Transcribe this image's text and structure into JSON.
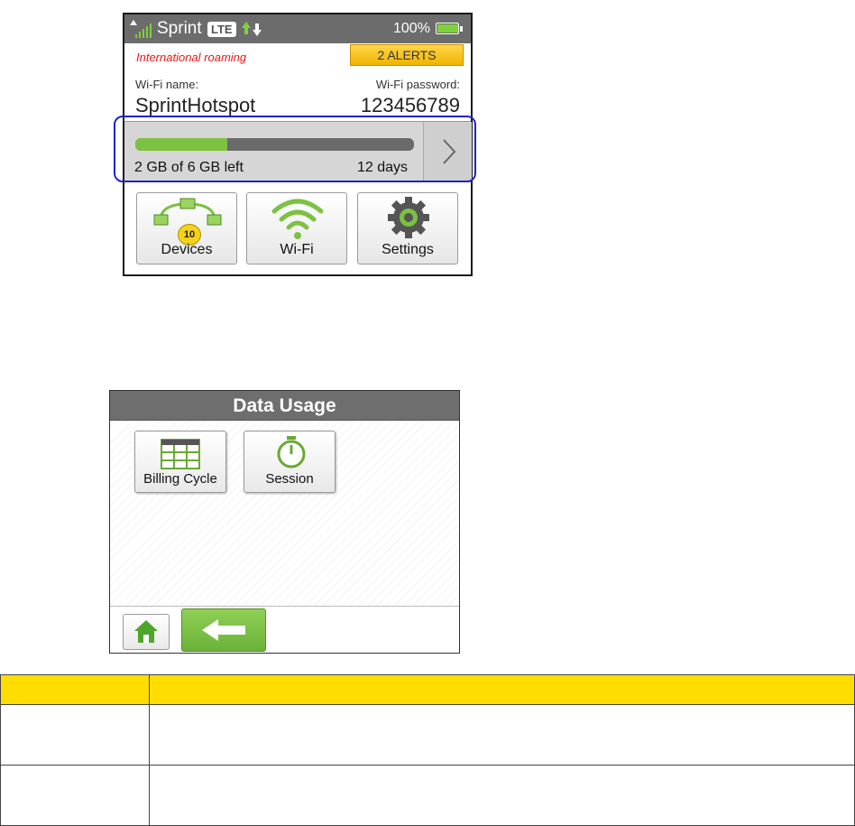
{
  "home_screen": {
    "status_bar": {
      "carrier": "Sprint",
      "network": "LTE",
      "battery_percent": "100%",
      "battery_level": 1.0
    },
    "roaming_text": "International roaming",
    "alerts_label": "2 ALERTS",
    "wifi_name_label": "Wi-Fi name:",
    "wifi_name": "SprintHotspot",
    "wifi_password_label": "Wi-Fi password:",
    "wifi_password": "123456789",
    "usage": {
      "left_text": "2 GB of 6 GB left",
      "days_text": "12 days",
      "used_fraction": 0.33
    },
    "tiles": [
      {
        "label": "Devices",
        "badge": "10",
        "icon": "devices-network-icon"
      },
      {
        "label": "Wi-Fi",
        "icon": "wifi-icon"
      },
      {
        "label": "Settings",
        "icon": "gear-icon"
      }
    ],
    "colors": {
      "accent_green": "#7dc142",
      "alert_yellow": "#f0b400",
      "roaming_red": "#e31a1a",
      "highlight_blue": "#2222cc"
    }
  },
  "data_usage_screen": {
    "title": "Data Usage",
    "tiles": [
      {
        "label": "Billing Cycle",
        "icon": "calendar-grid-icon"
      },
      {
        "label": "Session",
        "icon": "stopwatch-icon"
      }
    ],
    "footer": {
      "home_icon": "home-icon",
      "back_icon": "back-arrow-icon"
    }
  },
  "table": {
    "header": [
      "",
      ""
    ],
    "rows": [
      [
        "",
        ""
      ],
      [
        "",
        ""
      ]
    ],
    "header_color": "#ffdd00"
  }
}
